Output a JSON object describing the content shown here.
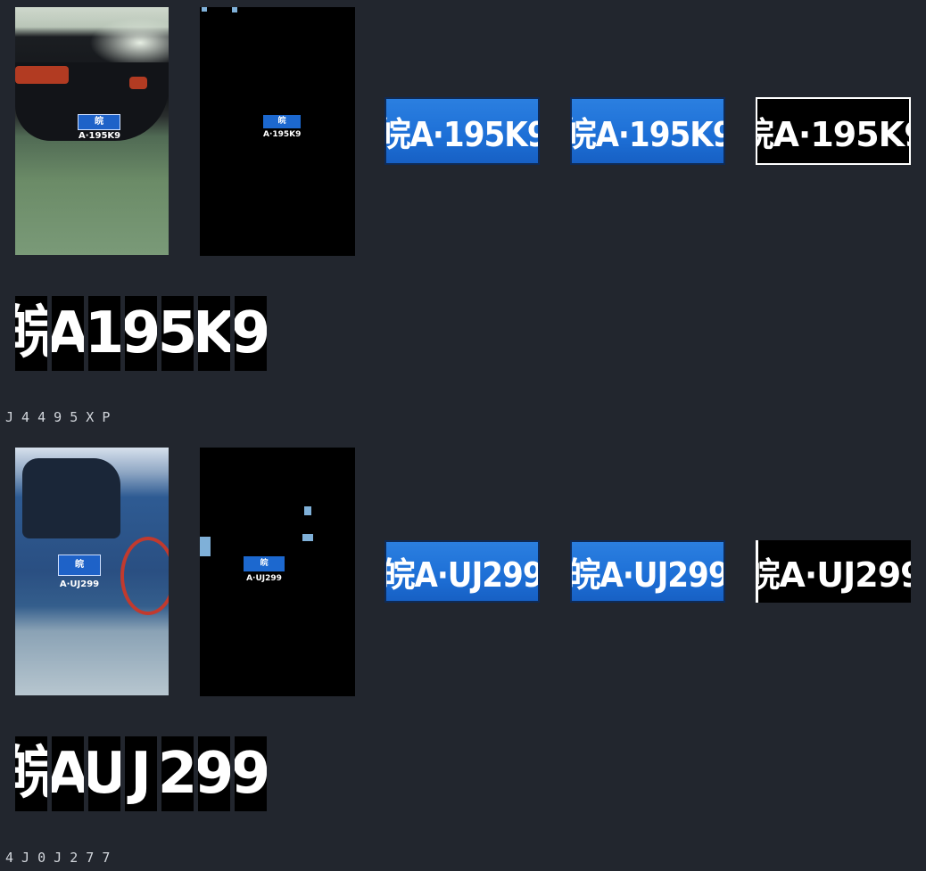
{
  "samples": [
    {
      "photo_plate": "皖A·195K9",
      "mask_plate": "皖A·195K9",
      "plate_crop": "皖A·195K9",
      "plate_crop_resized": "皖A·195K9",
      "plate_binary": "皖A·195K9",
      "chars": [
        "皖",
        "A",
        "1",
        "9",
        "5",
        "K",
        "9"
      ],
      "recognized": "J 4 4 9 5 X P"
    },
    {
      "photo_plate": "皖A·UJ299",
      "mask_plate": "皖A·UJ299",
      "plate_crop": "皖A·UJ299",
      "plate_crop_resized": "皖A·UJ299",
      "plate_binary": "皖A·UJ299",
      "chars": [
        "皖",
        "A",
        "U",
        "J",
        "2",
        "9",
        "9"
      ],
      "recognized": "4 J 0 J 2 7 7"
    }
  ]
}
